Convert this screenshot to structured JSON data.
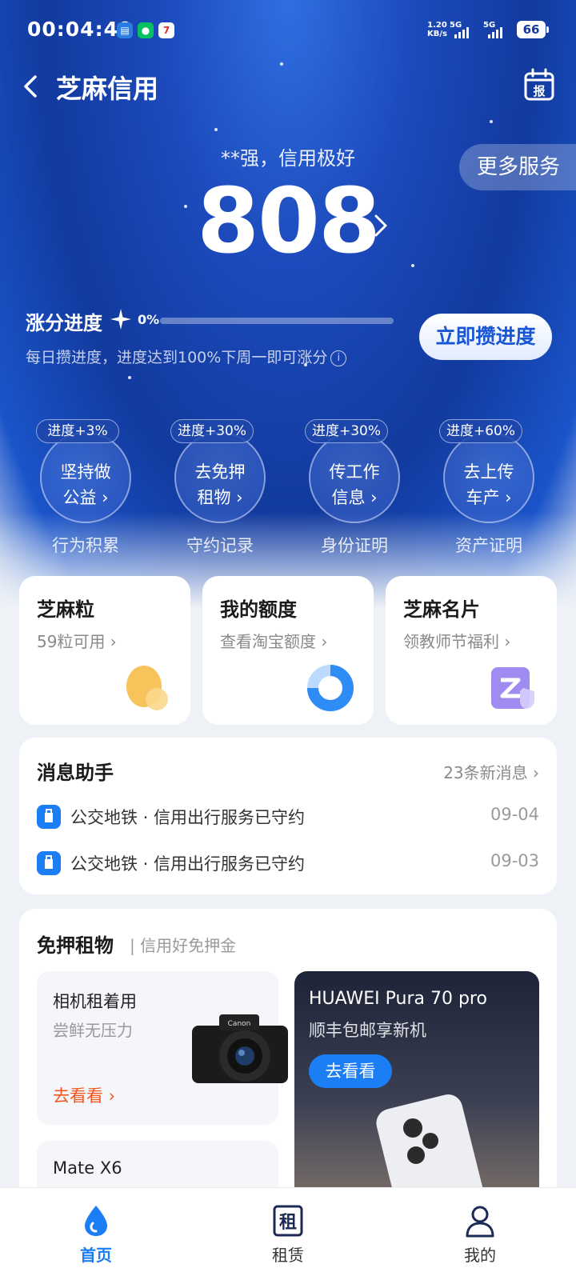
{
  "status_bar": {
    "time": "00:04:49",
    "net_speed_value": "1.20",
    "net_speed_unit": "KB/s",
    "signal1_label": "5G",
    "signal2_label": "5G",
    "battery": "66",
    "notification_icons": [
      "files-app-icon",
      "wechat-icon",
      "calendar-7-icon"
    ]
  },
  "nav": {
    "title": "芝麻信用",
    "more_services": "更多服务"
  },
  "credit": {
    "name_line": "**强，信用极好",
    "score": "808"
  },
  "progress": {
    "title": "涨分进度",
    "percent_text": "0%",
    "percent_value": 0,
    "tip": "每日攒进度，进度达到100%下周一即可涨分",
    "button": "立即攒进度"
  },
  "tasks": [
    {
      "badge": "进度+3%",
      "line1": "坚持做",
      "line2": "公益 ›",
      "label": "行为积累"
    },
    {
      "badge": "进度+30%",
      "line1": "去免押",
      "line2": "租物 ›",
      "label": "守约记录"
    },
    {
      "badge": "进度+30%",
      "line1": "传工作",
      "line2": "信息 ›",
      "label": "身份证明"
    },
    {
      "badge": "进度+60%",
      "line1": "去上传",
      "line2": "车产 ›",
      "label": "资产证明"
    }
  ],
  "features": [
    {
      "title": "芝麻粒",
      "sub": "59粒可用 ›"
    },
    {
      "title": "我的额度",
      "sub": "查看淘宝额度 ›"
    },
    {
      "title": "芝麻名片",
      "sub": "领教师节福利 ›"
    }
  ],
  "messages": {
    "title": "消息助手",
    "count": "23条新消息 ›",
    "items": [
      {
        "text": "公交地铁 · 信用出行服务已守约",
        "date": "09-04"
      },
      {
        "text": "公交地铁 · 信用出行服务已守约",
        "date": "09-03"
      }
    ]
  },
  "rent": {
    "title": "免押租物",
    "sub": "| 信用好免押金",
    "camera": {
      "title": "相机租着用",
      "sub": "尝鲜无压力",
      "cta": "去看看 ›",
      "brand": "Canon"
    },
    "matex": {
      "title": "Mate X6"
    },
    "huawei": {
      "title": "HUAWEI Pura 70 pro",
      "sub": "顺丰包邮享新机",
      "button": "去看看"
    }
  },
  "bottom_nav": {
    "tabs": [
      {
        "label": "首页",
        "icon": "home-drop-icon",
        "active": true
      },
      {
        "label": "租赁",
        "icon": "rent-icon"
      },
      {
        "label": "我的",
        "icon": "profile-icon"
      }
    ],
    "rent_icon_char": "租"
  },
  "colors": {
    "accent": "#1c7ef4",
    "hero_blue": "#123a9e",
    "cta_orange": "#f2561d"
  }
}
